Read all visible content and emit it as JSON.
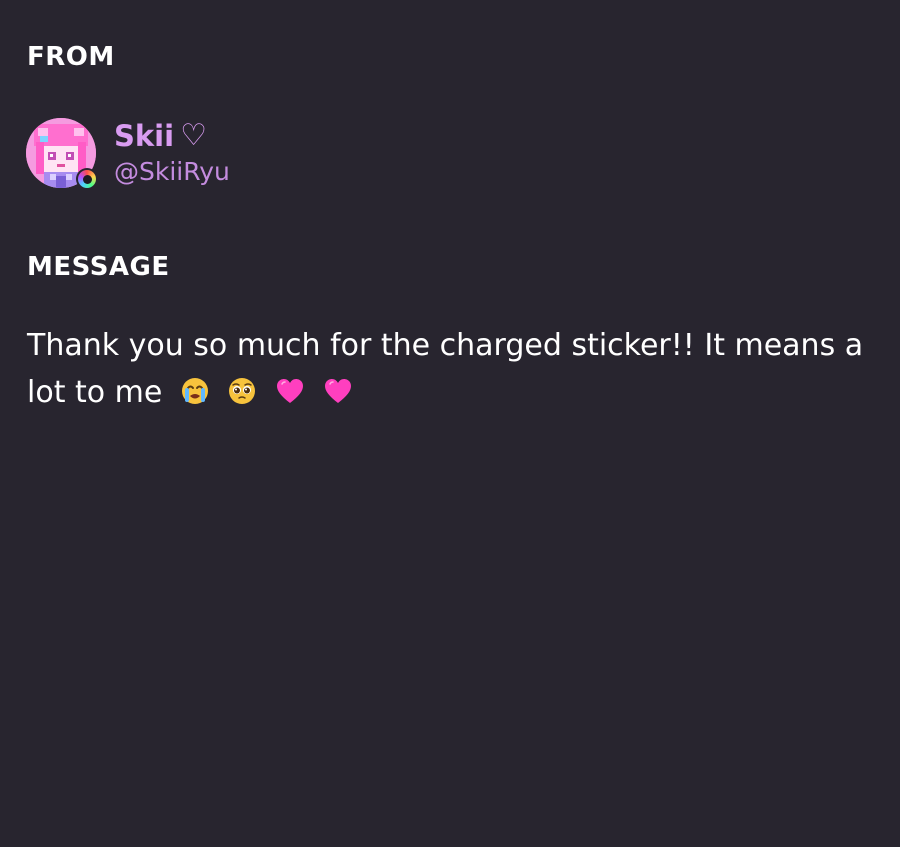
{
  "from": {
    "heading": "FROM",
    "sender": {
      "display_name": "Skii",
      "name_suffix_icon": "heart-outline-icon",
      "name_suffix_glyph": "♡",
      "handle": "@SkiiRyu",
      "avatar_icon": "avatar",
      "badge_icon": "rainbow-badge-icon"
    }
  },
  "message": {
    "heading": "MESSAGE",
    "text": "Thank you so much for the charged sticker!! It means a lot to me",
    "emojis": [
      "crying-face-icon",
      "pleading-face-icon",
      "pink-heart-icon",
      "pink-heart-icon"
    ]
  },
  "colors": {
    "background": "#28252f",
    "name": "#d99cf1",
    "handle": "#c48cdf",
    "text": "#ffffff"
  }
}
